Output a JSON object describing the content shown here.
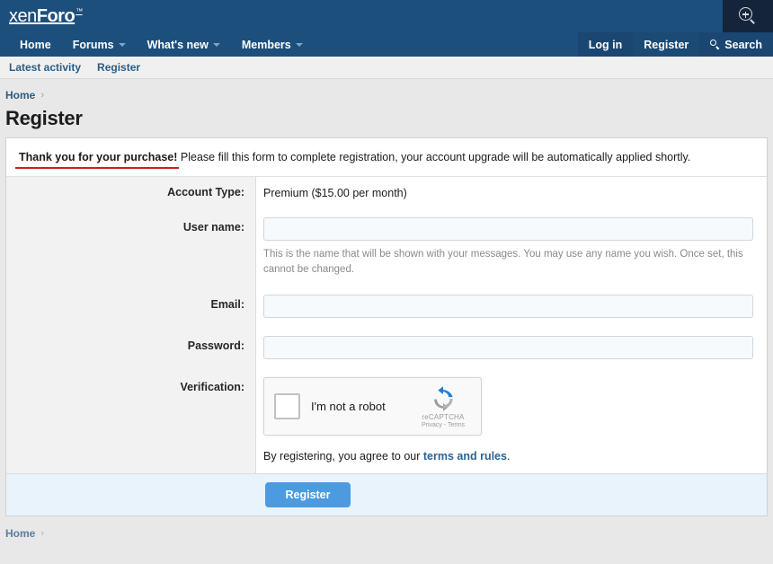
{
  "site": {
    "logo_primary": "xen",
    "logo_secondary": "Foro",
    "logo_tm": "™"
  },
  "header": {
    "zoom_icon": "magnifier-plus-icon",
    "nav_left": [
      {
        "label": "Home",
        "has_caret": false
      },
      {
        "label": "Forums",
        "has_caret": true
      },
      {
        "label": "What's new",
        "has_caret": true
      },
      {
        "label": "Members",
        "has_caret": true
      }
    ],
    "nav_right": [
      {
        "label": "Log in"
      },
      {
        "label": "Register"
      },
      {
        "label": "Search",
        "icon": "search-icon"
      }
    ]
  },
  "subnav": {
    "items": [
      {
        "label": "Latest activity"
      },
      {
        "label": "Register"
      }
    ]
  },
  "breadcrumb": {
    "home": "Home",
    "separator": "›"
  },
  "page": {
    "title": "Register"
  },
  "notice": {
    "highlight": "Thank you for your purchase!",
    "rest": " Please fill this form to complete registration, your account upgrade will be automatically applied shortly."
  },
  "form": {
    "account_type": {
      "label": "Account Type:",
      "value": "Premium ($15.00 per month)"
    },
    "username": {
      "label": "User name:",
      "value": "",
      "placeholder": "",
      "hint": "This is the name that will be shown with your messages. You may use any name you wish. Once set, this cannot be changed."
    },
    "email": {
      "label": "Email:",
      "value": "",
      "placeholder": ""
    },
    "password": {
      "label": "Password:",
      "value": "",
      "placeholder": ""
    },
    "verification": {
      "label": "Verification:",
      "recaptcha": {
        "checkbox_label": "I'm not a robot",
        "brand": "reCAPTCHA",
        "links": "Privacy - Terms"
      }
    },
    "terms": {
      "prefix": "By registering, you agree to our ",
      "link": "terms and rules",
      "suffix": "."
    },
    "submit_label": "Register"
  },
  "footer": {
    "home": "Home",
    "separator": "›"
  },
  "colors": {
    "header_blue": "#1d4f7c",
    "link_blue": "#2a5d86",
    "button_blue": "#4c9ae0",
    "annotation_red": "#cc1f1f",
    "footer_bar": "#e9f3fb"
  }
}
